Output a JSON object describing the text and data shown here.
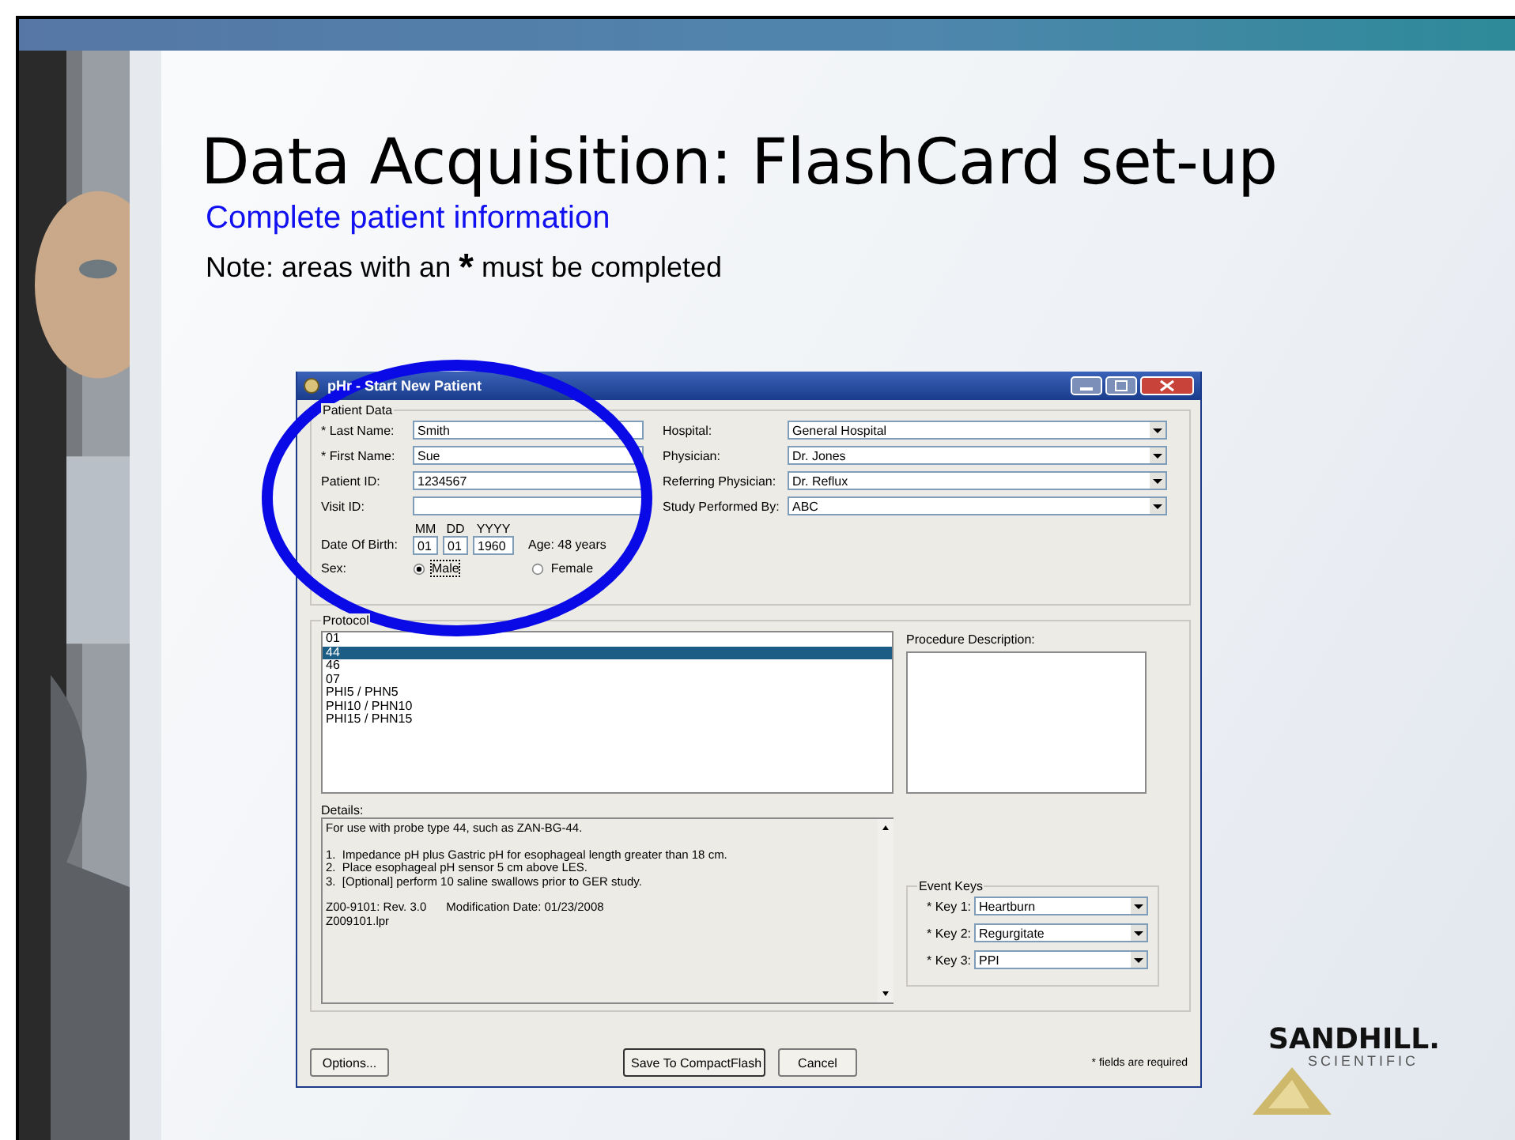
{
  "slide": {
    "title": "Data Acquisition: FlashCard set-up",
    "subtitle": "Complete patient information",
    "note": [
      "Note:  areas with an",
      "*",
      "must be completed"
    ]
  },
  "window": {
    "title": "pHr - Start New Patient"
  },
  "patient_data": {
    "legend": "Patient Data",
    "fields": [
      {
        "label": "* Last Name:",
        "value": "Smith"
      },
      {
        "label": "* First Name:",
        "value": "Sue"
      },
      {
        "label": "Patient ID:",
        "value": "1234567"
      },
      {
        "label": "Visit ID:"
      }
    ],
    "dob": {
      "label": "Date Of Birth:",
      "parts": [
        {
          "caption": "MM",
          "value": "01"
        },
        {
          "caption": "DD",
          "value": "01"
        },
        {
          "caption": "YYYY",
          "value": "1960"
        }
      ],
      "age": "Age:  48 years"
    },
    "sex": {
      "label": "Sex:",
      "options": [
        {
          "label": "Male",
          "selected": true
        },
        {
          "label": "Female",
          "selected": false
        }
      ]
    },
    "combos": [
      {
        "label": "Hospital:",
        "value": "General Hospital"
      },
      {
        "label": "Physician:",
        "value": "Dr. Jones"
      },
      {
        "label": "Referring Physician:",
        "value": "Dr. Reflux"
      },
      {
        "label": "Study Performed By:",
        "value": "ABC"
      }
    ]
  },
  "protocol": {
    "legend": "Protocol",
    "items": [
      {
        "label": "01",
        "selected": false
      },
      {
        "label": "44",
        "selected": true
      },
      {
        "label": "46",
        "selected": false
      },
      {
        "label": "07",
        "selected": false
      },
      {
        "label": "PHI5 / PHN5",
        "selected": false
      },
      {
        "label": "PHI10 / PHN10",
        "selected": false
      },
      {
        "label": "PHI15 / PHN15",
        "selected": false
      }
    ],
    "procedure_label": "Procedure Description:",
    "details_label": "Details:",
    "details": [
      [
        "For use with probe type 44, such as ZAN-BG-44."
      ],
      [
        "1.  Impedance pH plus Gastric pH for esophageal length greater than 18 cm.",
        "2.  Place esophageal pH sensor 5 cm above LES.",
        "3.  [Optional] perform 10 saline swallows prior to GER study."
      ],
      [
        "Z00-9101: Rev. 3.0      Modification Date: 01/23/2008",
        "Z009101.lpr"
      ]
    ],
    "event_keys": {
      "legend": "Event Keys",
      "keys": [
        {
          "label": "* Key 1:",
          "value": "Heartburn"
        },
        {
          "label": "* Key 2:",
          "value": "Regurgitate"
        },
        {
          "label": "* Key 3:",
          "value": "PPI"
        }
      ]
    }
  },
  "buttons": {
    "options": "Options...",
    "save": "Save To CompactFlash",
    "cancel": "Cancel"
  },
  "footnote": "* fields are required",
  "logo": {
    "name": "SANDHILL.",
    "sub": "SCIENTIFIC"
  }
}
